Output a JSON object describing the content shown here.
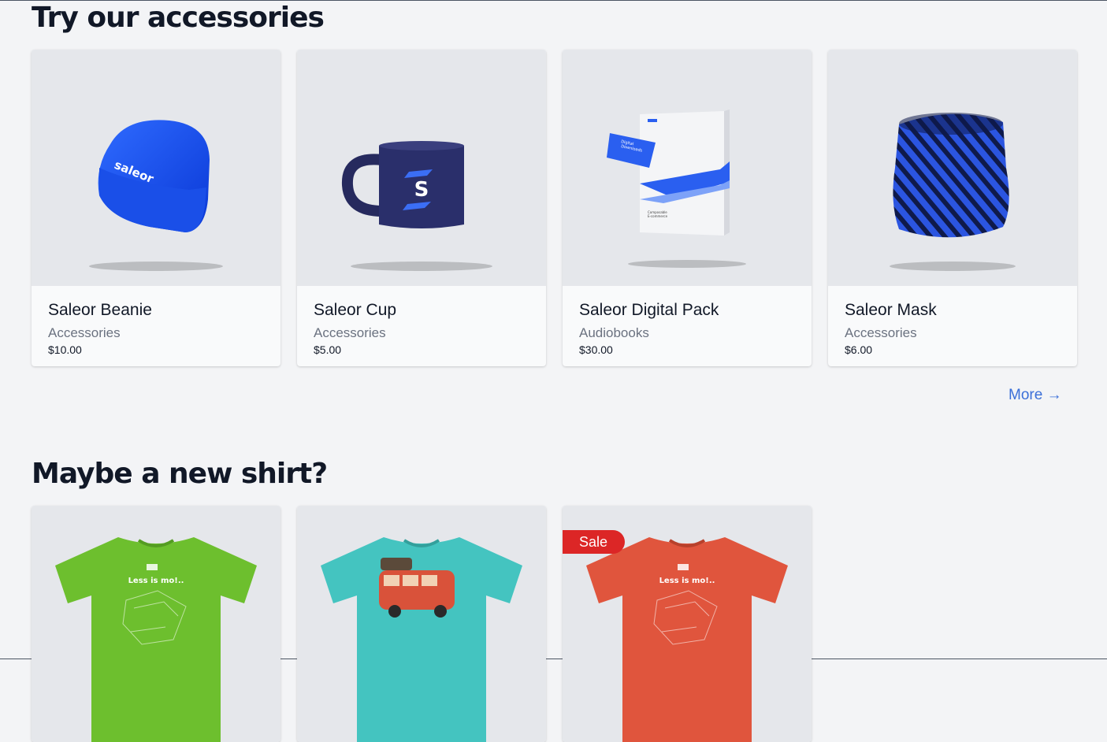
{
  "accessories": {
    "title": "Try our accessories",
    "more_label": "More →",
    "products": [
      {
        "name": "Saleor Beanie",
        "category": "Accessories",
        "price": "$10.00",
        "icon": "beanie-image"
      },
      {
        "name": "Saleor Cup",
        "category": "Accessories",
        "price": "$5.00",
        "icon": "cup-image"
      },
      {
        "name": "Saleor Digital Pack",
        "category": "Audiobooks",
        "price": "$30.00",
        "icon": "digital-pack-image"
      },
      {
        "name": "Saleor Mask",
        "category": "Accessories",
        "price": "$6.00",
        "icon": "mask-image"
      }
    ]
  },
  "shirts": {
    "title": "Maybe a new shirt?",
    "products": [
      {
        "icon": "green-tshirt-image",
        "color": "#6dbf2e"
      },
      {
        "icon": "turquoise-tshirt-image",
        "color": "#44c4c0"
      },
      {
        "icon": "red-tshirt-image",
        "color": "#e0553d",
        "badge": "Sale"
      }
    ]
  },
  "colors": {
    "background": "#f3f4f6",
    "link": "#3b6fd8",
    "sale_badge": "#dc2626",
    "brand_blue": "#1d4ed8"
  }
}
